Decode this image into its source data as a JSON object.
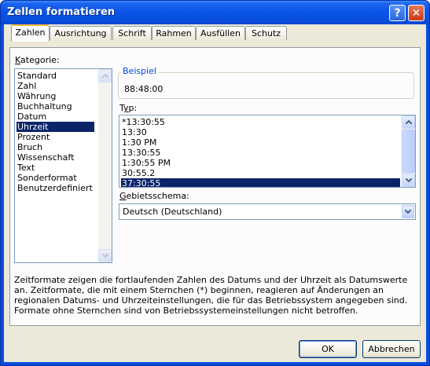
{
  "window": {
    "title": "Zellen formatieren",
    "help_label": "?",
    "close_label": "✕"
  },
  "tabs": [
    {
      "label": "Zahlen"
    },
    {
      "label": "Ausrichtung"
    },
    {
      "label": "Schrift"
    },
    {
      "label": "Rahmen"
    },
    {
      "label": "Ausfüllen"
    },
    {
      "label": "Schutz"
    }
  ],
  "category": {
    "label": "Kategorie:",
    "selected": "Uhrzeit",
    "items": [
      "Standard",
      "Zahl",
      "Währung",
      "Buchhaltung",
      "Datum",
      "Uhrzeit",
      "Prozent",
      "Bruch",
      "Wissenschaft",
      "Text",
      "Sonderformat",
      "Benutzerdefiniert"
    ]
  },
  "sample": {
    "label": "Beispiel",
    "value": "88:48:00"
  },
  "type": {
    "label": "Typ:",
    "selected": "37:30:55",
    "items": [
      "*13:30:55",
      "13:30",
      "1:30 PM",
      "13:30:55",
      "1:30:55 PM",
      "30:55.2",
      "37:30:55"
    ]
  },
  "locale": {
    "label": "Gebietsschema:",
    "value": "Deutsch (Deutschland)"
  },
  "description": "Zeitformate zeigen die fortlaufenden Zahlen des Datums und der Uhrzeit als Datumswerte an. Zeitformate, die mit einem Sternchen (*) beginnen, reagieren auf Änderungen an regionalen Datums- und Uhrzeiteinstellungen, die für das Betriebssystem angegeben sind. Formate ohne Sternchen sind von Betriebssystemeinstellungen nicht betroffen.",
  "buttons": {
    "ok": "OK",
    "cancel": "Abbrechen"
  },
  "colors": {
    "titlebar": "#0a54e6",
    "selection": "#0a246a",
    "dialog_bg": "#ece9d8",
    "group_title": "#0046d5"
  }
}
